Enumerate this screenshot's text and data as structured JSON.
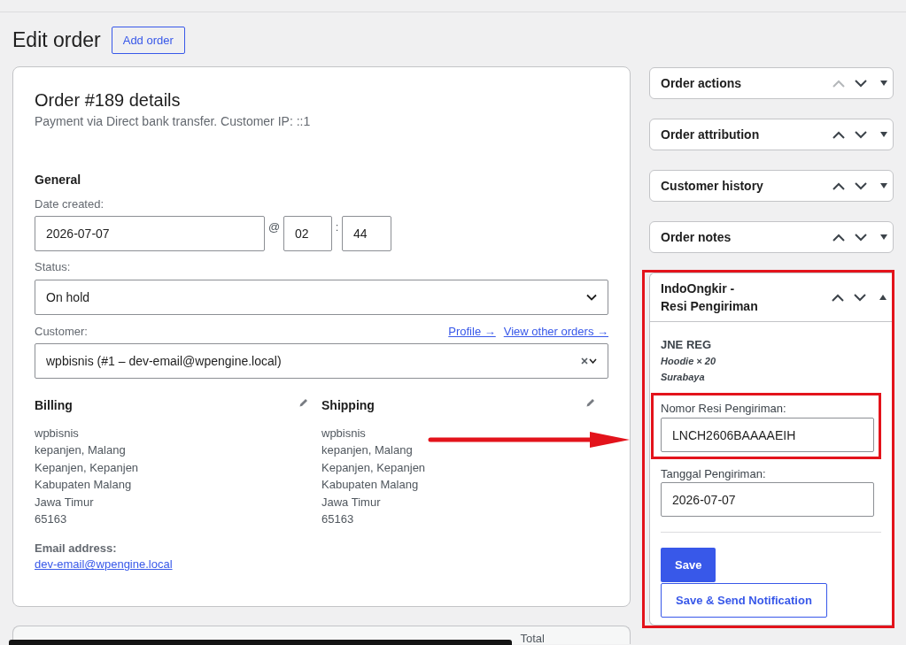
{
  "page": {
    "title": "Edit order",
    "add_button": "Add order"
  },
  "order": {
    "title": "Order #189 details",
    "subtitle": "Payment via Direct bank transfer. Customer IP: ::1",
    "general": {
      "heading": "General",
      "date_label": "Date created:",
      "date": "2026-07-07",
      "at": "@",
      "hour": "02",
      "separator": ":",
      "minute": "44",
      "status_label": "Status:",
      "status": "On hold",
      "customer_label": "Customer:",
      "customer_links": [
        "Profile →",
        "View other orders →"
      ],
      "customer": "wpbisnis (#1 – dev-email@wpengine.local)"
    },
    "addresses": [
      {
        "heading": "Billing",
        "lines": [
          "wpbisnis",
          "kepanjen, Malang",
          "Kepanjen, Kepanjen",
          "Kabupaten Malang",
          "Jawa Timur",
          "65163"
        ]
      },
      {
        "heading": "Shipping",
        "lines": [
          "wpbisnis",
          "kepanjen, Malang",
          "Kepanjen, Kepanjen",
          "Kabupaten Malang",
          "Jawa Timur",
          "65163"
        ]
      }
    ],
    "email_label": "Email address:",
    "email": "dev-email@wpengine.local"
  },
  "items_table": {
    "columns": [
      "Total"
    ]
  },
  "sidebar": {
    "boxes": [
      {
        "title": "Order actions",
        "expanded": false,
        "up_disabled": true,
        "highlighted": false
      },
      {
        "title": "Order attribution",
        "expanded": false,
        "up_disabled": false,
        "highlighted": false
      },
      {
        "title": "Customer history",
        "expanded": false,
        "up_disabled": false,
        "highlighted": false
      },
      {
        "title": "Order notes",
        "expanded": false,
        "up_disabled": false,
        "highlighted": false
      },
      {
        "title": "IndoOngkir -\nResi Pengiriman",
        "expanded": true,
        "up_disabled": false,
        "highlighted": true,
        "body": {
          "carrier": "JNE REG",
          "item": "Hoodie × 20",
          "destination": "Surabaya",
          "fields": [
            {
              "label": "Nomor Resi Pengiriman:",
              "value": "LNCH2606BAAAAEIH",
              "highlighted": true
            },
            {
              "label": "Tanggal Pengiriman:",
              "value": "2026-07-07",
              "highlighted": false
            }
          ],
          "buttons": [
            {
              "label": "Save",
              "kind": "primary"
            },
            {
              "label": "Save & Send Notification",
              "kind": "secondary"
            }
          ]
        }
      }
    ]
  },
  "annotations": [
    {
      "kind": "arrow"
    }
  ]
}
